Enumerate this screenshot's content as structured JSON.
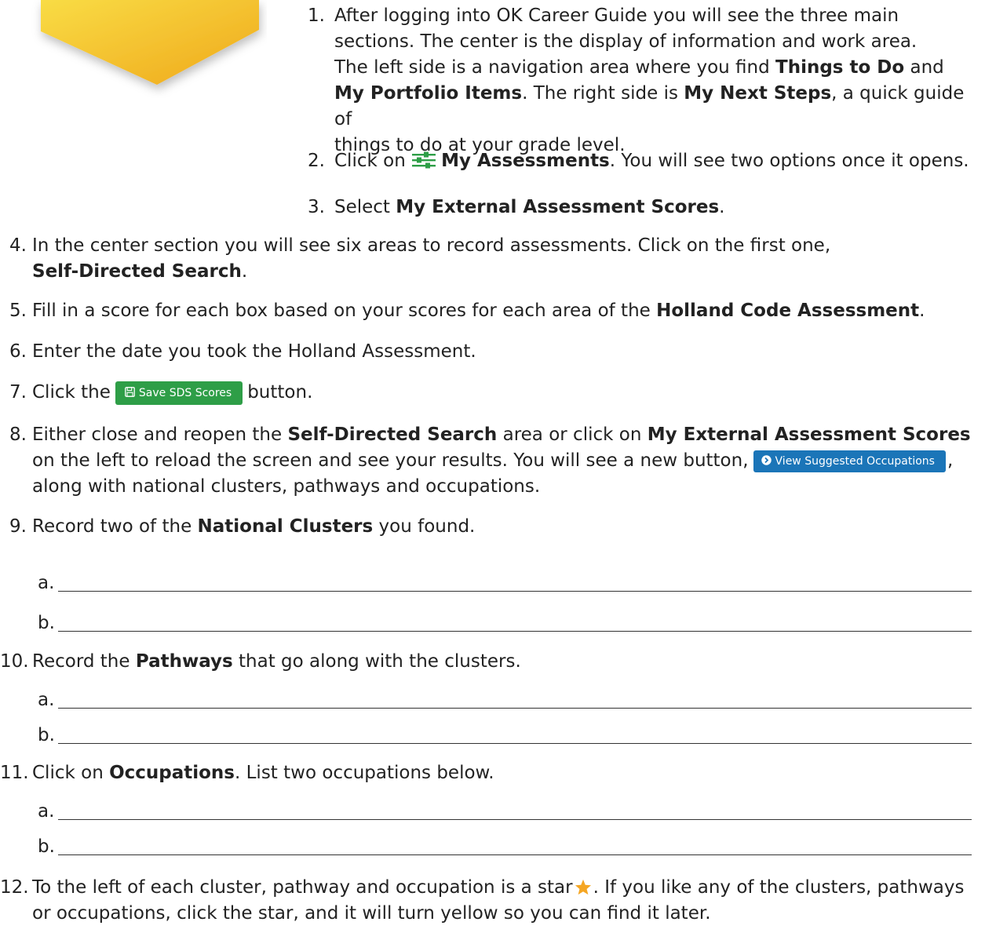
{
  "colors": {
    "yellow_light": "#f7d233",
    "yellow_dark": "#f0b21b",
    "green_button": "#2e9e47",
    "blue_button": "#1b75b8",
    "star": "#f5a623",
    "menu_icon": "#2e9e47"
  },
  "icons": {
    "corner_graphic": "yellow-diamond-shape",
    "assessments": "sliders-icon",
    "save": "floppy-disk-icon",
    "view": "circle-arrow-right-icon",
    "favorite": "star-icon"
  },
  "steps": [
    {
      "number": "1.",
      "lines": [
        [
          "After logging into OK Career Guide you will see the three main"
        ],
        [
          "sections. The center is the display of information and work area."
        ],
        [
          "The left side is a navigation area where you find ",
          "Things to Do",
          " and"
        ],
        [
          "",
          "My Portfolio Items",
          ".  The right side is ",
          "My Next Steps",
          ", a quick guide of"
        ],
        [
          "things to do at your grade level."
        ]
      ]
    },
    {
      "number": "2.",
      "before": "Click on ",
      "bold": "My Assessments",
      "after": ". You will see two options once it opens."
    },
    {
      "number": "3.",
      "before": "Select ",
      "bold": "My External Assessment Scores",
      "after": "."
    },
    {
      "number": "4.",
      "line1": "In the center section you will see six areas to record assessments. Click on the first one,",
      "bold": "Self-Directed Search",
      "after": "."
    },
    {
      "number": "5.",
      "before": "Fill in a score for each box based on your scores for each area of the ",
      "bold": "Holland Code Assessment",
      "after": "."
    },
    {
      "number": "6.",
      "text": "Enter the date you took the Holland Assessment."
    },
    {
      "number": "7.",
      "before": "Click the",
      "button": "Save SDS Scores",
      "after": "button."
    },
    {
      "number": "8.",
      "l1_before": "Either close and reopen the ",
      "l1_bold1": "Self-Directed Search",
      "l1_mid": " area or click on ",
      "l1_bold2": "My External Assessment Scores",
      "l2_before": "on the left to reload the screen and see your results. You will see a new button,",
      "button": "View Suggested Occupations",
      "l2_after": ",",
      "l3": "along with national clusters, pathways and occupations."
    },
    {
      "number": "9.",
      "before": "Record two of the ",
      "bold": "National Clusters",
      "after": " you found."
    },
    {
      "number": "10.",
      "before": "Record the ",
      "bold": "Pathways",
      "after": " that go along with the clusters."
    },
    {
      "number": "11.",
      "before": "Click on ",
      "bold": "Occupations",
      "after": ".  List two occupations below."
    },
    {
      "number": "12.",
      "l1_before": "To the left of each cluster, pathway and occupation is a star",
      "l1_after": ". If you like any of the clusters, pathways",
      "l2": "or occupations, click the star, and it will turn yellow so you can find it later."
    }
  ],
  "answer_labels": {
    "a": "a.",
    "b": "b."
  }
}
